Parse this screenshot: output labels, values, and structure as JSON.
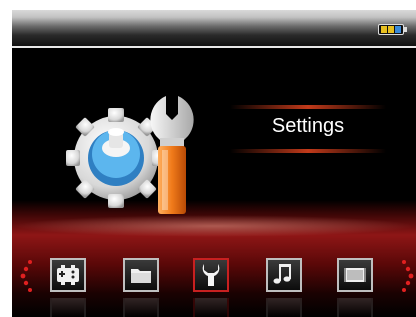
{
  "status_bar": {
    "battery_icon": "battery-icon",
    "battery_cell_colors": [
      "#e8c020",
      "#e8c020",
      "#3a8ad8"
    ]
  },
  "main": {
    "title": "Settings",
    "hero_icon": "gear-wrench-icon"
  },
  "menu": {
    "items": [
      {
        "name": "games",
        "icon": "gamepad-icon",
        "selected": false
      },
      {
        "name": "files",
        "icon": "folder-icon",
        "selected": false
      },
      {
        "name": "settings",
        "icon": "wrench-icon",
        "selected": true
      },
      {
        "name": "music",
        "icon": "music-note-icon",
        "selected": false
      },
      {
        "name": "video",
        "icon": "film-icon",
        "selected": false
      }
    ]
  },
  "colors": {
    "selected_border": "#c82020",
    "accent_red": "#8e1616",
    "gear_blue": "#3aa0e0",
    "wrench_orange": "#f07a1a"
  }
}
